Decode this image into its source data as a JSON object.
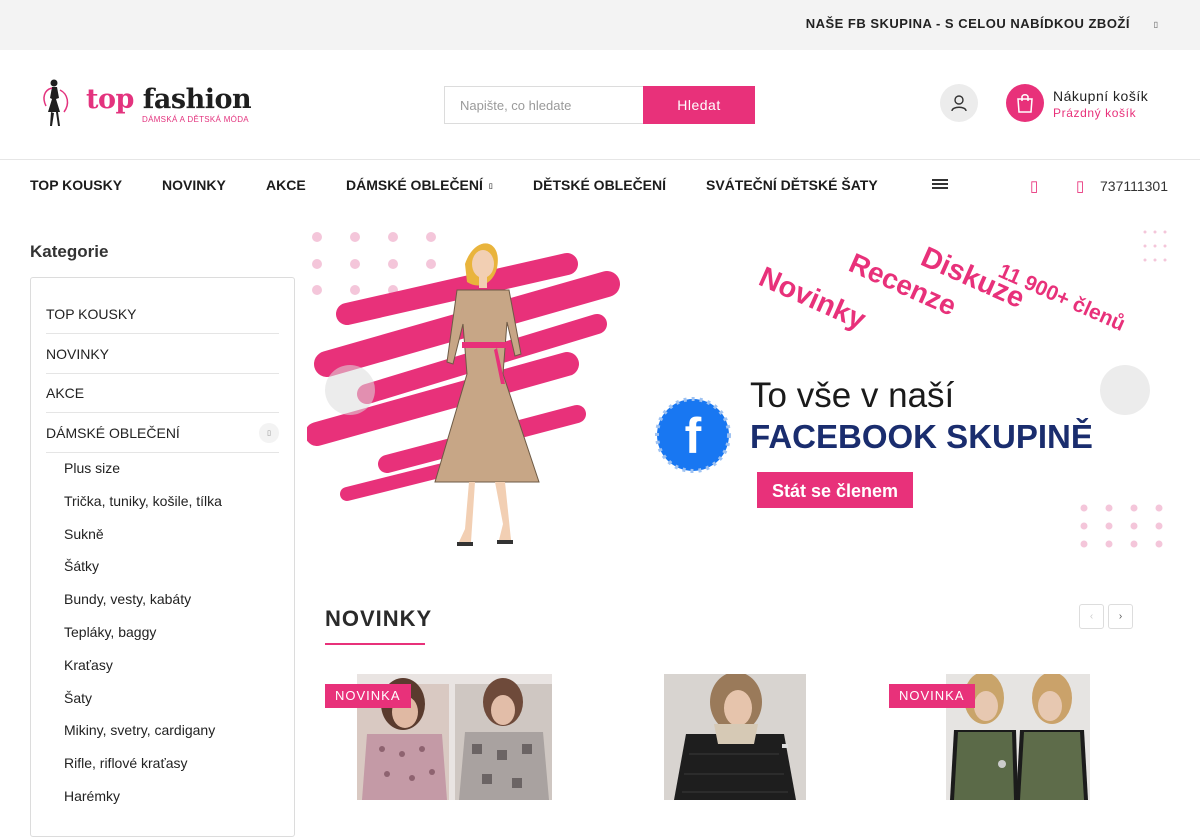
{
  "topbar": {
    "fb_group_link": "NAŠE FB SKUPINA - S CELOU NABÍDKOU ZBOŽÍ",
    "caret": "▯"
  },
  "logo": {
    "brand_pink": "top",
    "brand_dark": "fashion",
    "tagline": "DÁMSKÁ A DĚTSKÁ MÓDA"
  },
  "search": {
    "placeholder": "Napište, co hledate",
    "value": "",
    "button": "Hledat"
  },
  "cart": {
    "title": "Nákupní košík",
    "status": "Prázdný košík"
  },
  "nav": {
    "items": [
      "TOP KOUSKY",
      "NOVINKY",
      "AKCE",
      "DÁMSKÉ OBLEČENÍ",
      "DĚTSKÉ OBLEČENÍ",
      "SVÁTEČNÍ DĚTSKÉ ŠATY"
    ],
    "caret": "▯",
    "heart_icon": "▯",
    "phone_icon": "▯",
    "phone": "737111301"
  },
  "sidebar": {
    "title": "Kategorie",
    "categories": [
      "TOP KOUSKY",
      "NOVINKY",
      "AKCE",
      "DÁMSKÉ OBLEČENÍ"
    ],
    "toggle": "▯",
    "subcategories": [
      "Plus size",
      "Trička, tuniky, košile, tílka",
      "Sukně",
      "Šátky",
      "Bundy, vesty, kabáty",
      "Tepláky, baggy",
      "Kraťasy",
      "Šaty",
      "Mikiny, svetry, cardigany",
      "Rifle, riflové kraťasy",
      "Harémky"
    ]
  },
  "banner": {
    "words": [
      "Novinky",
      "Recenze",
      "Diskuze",
      "11 900+ členů"
    ],
    "line1": "To vše v naší",
    "line2": "FACEBOOK SKUPINĚ",
    "cta": "Stát se členem",
    "fb_letter": "f",
    "arrow_left": "▯",
    "arrow_right": "▯"
  },
  "section": {
    "title": "NOVINKY",
    "prev": "‹",
    "next": "›"
  },
  "products": [
    {
      "badge": "NOVINKA"
    },
    {
      "badge": ""
    },
    {
      "badge": "NOVINKA"
    }
  ],
  "colors": {
    "accent": "#e8317a",
    "dark": "#222222",
    "topbar_bg": "#f3f3f3"
  }
}
